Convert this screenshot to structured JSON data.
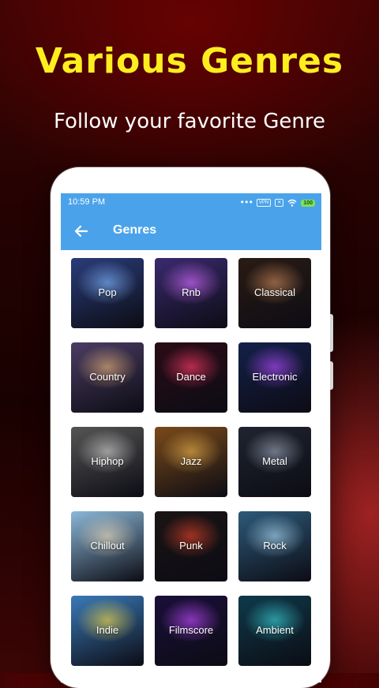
{
  "promo": {
    "headline": "Various Genres",
    "subline": "Follow your favorite Genre"
  },
  "status_bar": {
    "time": "10:59  PM",
    "signal_dots": "•••",
    "badge_a": "VPN",
    "badge_b": "✕",
    "battery": "100"
  },
  "app_bar": {
    "back_icon": "arrow-left-icon",
    "title": "Genres"
  },
  "genres": [
    {
      "label": "Pop",
      "bg": "#2a3d7a",
      "accent": "#7fb4ff"
    },
    {
      "label": "Rnb",
      "bg": "#3a2a6e",
      "accent": "#d36bff"
    },
    {
      "label": "Classical",
      "bg": "#2a1b14",
      "accent": "#c9875a"
    },
    {
      "label": "Country",
      "bg": "#4b3d63",
      "accent": "#e6b07a"
    },
    {
      "label": "Dance",
      "bg": "#2a0c16",
      "accent": "#ff3a6a"
    },
    {
      "label": "Electronic",
      "bg": "#14204a",
      "accent": "#b24bff"
    },
    {
      "label": "Hiphop",
      "bg": "#555555",
      "accent": "#cfcfcf"
    },
    {
      "label": "Jazz",
      "bg": "#7a4a1a",
      "accent": "#e7b04a"
    },
    {
      "label": "Metal",
      "bg": "#1f2430",
      "accent": "#9aa3b5"
    },
    {
      "label": "Chillout",
      "bg": "#8bb8d8",
      "accent": "#e8d6b8"
    },
    {
      "label": "Punk",
      "bg": "#1a1414",
      "accent": "#e0422a"
    },
    {
      "label": "Rock",
      "bg": "#2d5a7a",
      "accent": "#a9d6f0"
    },
    {
      "label": "Indie",
      "bg": "#3a7ab8",
      "accent": "#f0d84a"
    },
    {
      "label": "Filmscore",
      "bg": "#1a0f3a",
      "accent": "#c04bff"
    },
    {
      "label": "Ambient",
      "bg": "#0e3a4a",
      "accent": "#3ad0d8"
    }
  ]
}
